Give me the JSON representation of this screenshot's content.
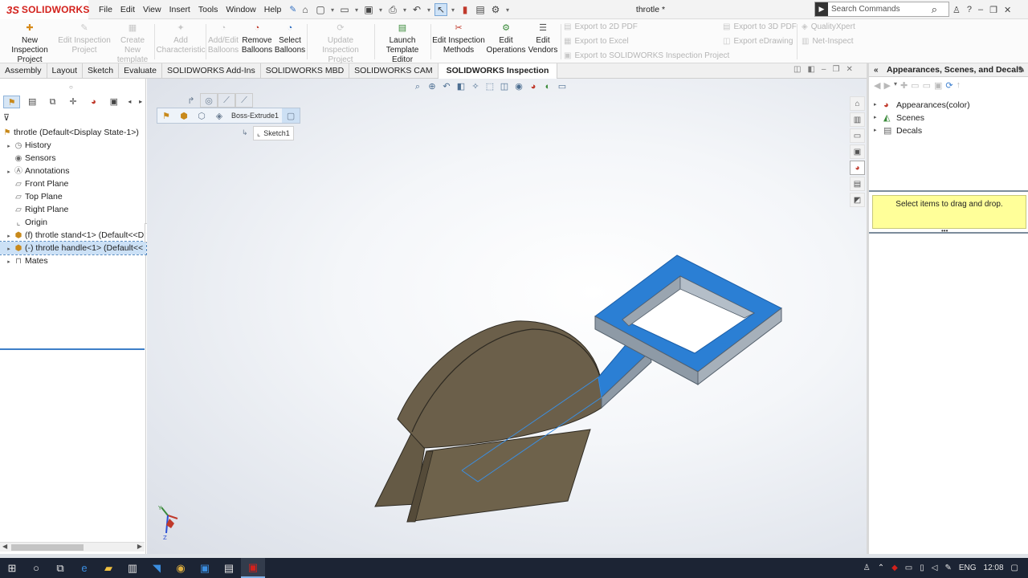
{
  "app": {
    "brand_ds": "3S",
    "brand_name": "SOLIDWORKS",
    "document_title": "throtle *"
  },
  "menu": [
    "File",
    "Edit",
    "View",
    "Insert",
    "Tools",
    "Window",
    "Help"
  ],
  "search": {
    "placeholder": "Search Commands"
  },
  "ribbon": {
    "new_inspection_project": {
      "line1": "New Inspection",
      "line2": "Project"
    },
    "edit_inspection_project": {
      "line1": "Edit Inspection",
      "line2": "Project"
    },
    "create_new_template": {
      "line1": "Create New",
      "line2": "template"
    },
    "add_characteristic": {
      "line1": "Add",
      "line2": "Characteristic"
    },
    "add_edit_balloons": {
      "line1": "Add/Edit",
      "line2": "Balloons"
    },
    "remove_balloons": {
      "line1": "Remove",
      "line2": "Balloons"
    },
    "select_balloons": {
      "line1": "Select",
      "line2": "Balloons"
    },
    "update_inspection_project": {
      "line1": "Update Inspection",
      "line2": "Project"
    },
    "launch_template_editor": {
      "line1": "Launch",
      "line2": "Template Editor"
    },
    "edit_inspection_methods": {
      "line1": "Edit Inspection",
      "line2": "Methods"
    },
    "edit_operations": {
      "line1": "Edit",
      "line2": "Operations"
    },
    "edit_vendors": {
      "line1": "Edit",
      "line2": "Vendors"
    },
    "export_2d_pdf": "Export to 2D PDF",
    "export_excel": "Export to Excel",
    "export_inspection_project": "Export to SOLIDWORKS Inspection Project",
    "export_3d_pdf": "Export to 3D PDF",
    "export_edrawing": "Export eDrawing",
    "qualityxpert": "QualityXpert",
    "net_inspect": "Net-Inspect"
  },
  "tabs": [
    "Assembly",
    "Layout",
    "Sketch",
    "Evaluate",
    "SOLIDWORKS Add-Ins",
    "SOLIDWORKS MBD",
    "SOLIDWORKS CAM",
    "SOLIDWORKS Inspection"
  ],
  "feature_tree": {
    "root": "throtle  (Default<Display State-1>)",
    "items": [
      "History",
      "Sensors",
      "Annotations",
      "Front Plane",
      "Top Plane",
      "Right Plane",
      "Origin",
      "(f) throtle stand<1> (Default<<D",
      "(-) throtle handle<1> (Default<<",
      "Mates"
    ]
  },
  "breadcrumb": {
    "feature": "Boss-Extrude1",
    "sketch": "Sketch1"
  },
  "task_pane": {
    "title": "Appearances, Scenes, and Decals",
    "items": [
      "Appearances(color)",
      "Scenes",
      "Decals"
    ],
    "hint": "Select items to drag and drop."
  },
  "triad": {
    "y": "Y",
    "z": "Z"
  },
  "taskbar": {
    "language": "ENG",
    "time": "12:08"
  },
  "colors": {
    "part_body": "#6b5f4a",
    "handle_blue": "#2b7fd4",
    "hint_bg": "#ffff99"
  }
}
